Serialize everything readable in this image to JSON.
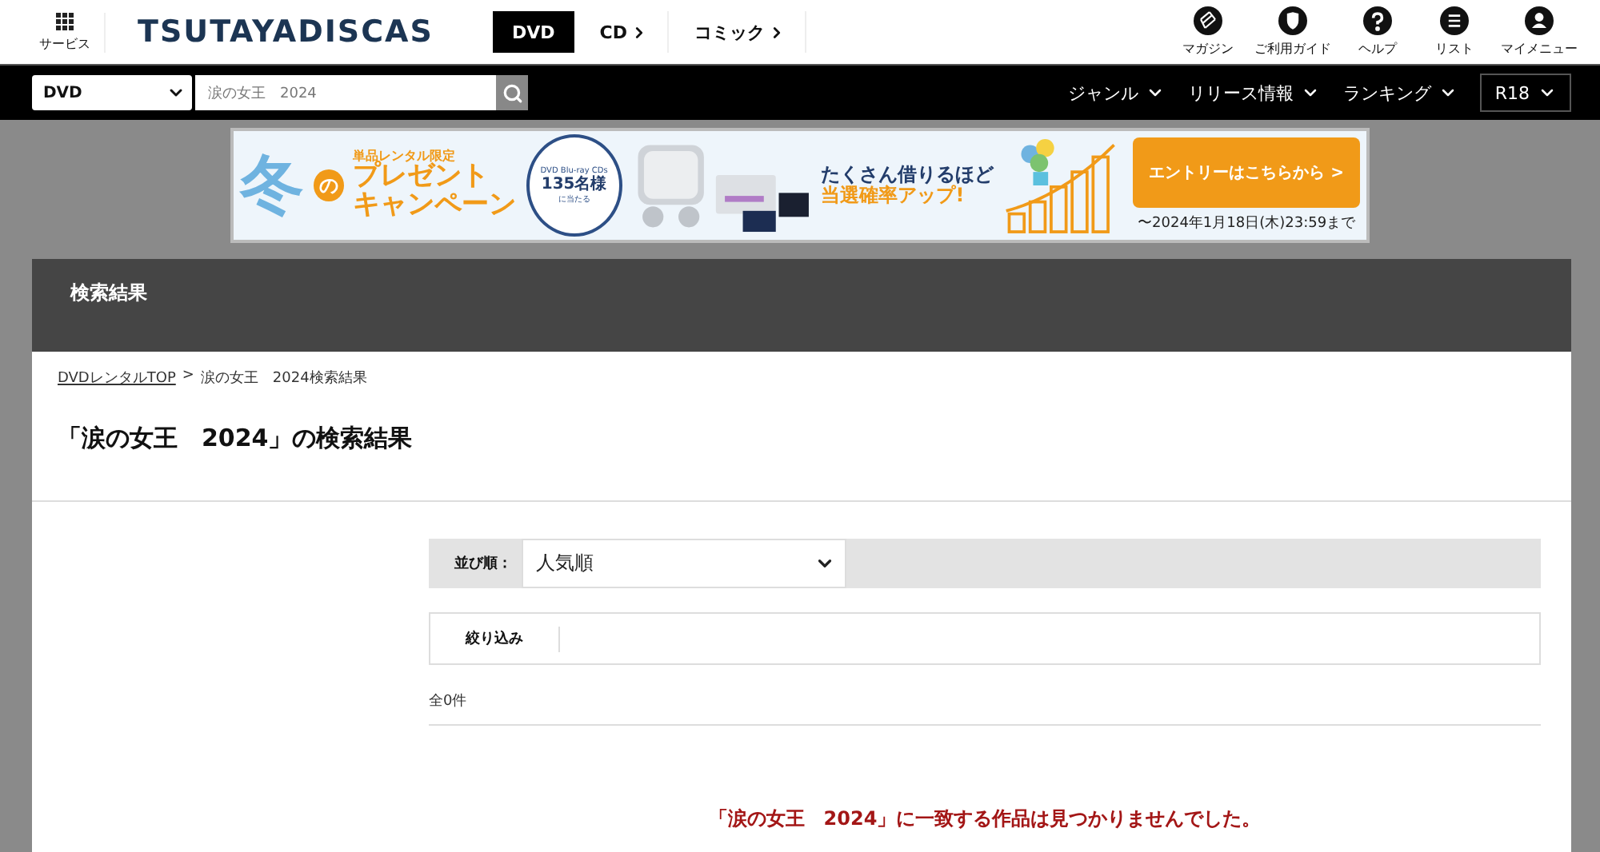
{
  "header": {
    "service_label": "サービス",
    "logo": "TSUTAYADISCAS",
    "media_tabs": [
      {
        "label": "DVD",
        "selected": true
      },
      {
        "label": "CD",
        "selected": false
      },
      {
        "label": "コミック",
        "selected": false
      }
    ],
    "utility_links": [
      {
        "label": "マガジン"
      },
      {
        "label": "ご利用ガイド"
      },
      {
        "label": "ヘルプ"
      },
      {
        "label": "リスト"
      },
      {
        "label": "マイメニュー"
      }
    ]
  },
  "search_bar": {
    "category": "DVD",
    "query": "涙の女王　2024",
    "menus": [
      {
        "label": "ジャンル",
        "kind": "plain"
      },
      {
        "label": "リリース情報",
        "kind": "plain"
      },
      {
        "label": "ランキング",
        "kind": "plain"
      },
      {
        "label": "R18",
        "kind": "boxed"
      }
    ]
  },
  "banner": {
    "season": "冬",
    "particle": "の",
    "ribbon": "単品レンタル限定",
    "title_1": "プレゼント",
    "title_2": "キャンペーン",
    "badge_top": "DVD Blu-ray CDs",
    "badge_count": "135名様",
    "badge_bottom": "に当たる",
    "tagline_1": "たくさん借りるほど",
    "tagline_2": "当選確率アップ!",
    "cta": "エントリーはこちらから >",
    "deadline": "〜2024年1月18日(木)23:59まで"
  },
  "panel": {
    "title": "検索結果",
    "breadcrumb": [
      {
        "label": "DVDレンタルTOP",
        "kind": "link"
      },
      {
        "label": "涙の女王　2024検索結果",
        "kind": "current"
      }
    ],
    "breadcrumb_separator": ">",
    "heading": "「涙の女王　2024」の検索結果",
    "sort": {
      "label": "並び順：",
      "value": "人気順"
    },
    "filter_label": "絞り込み",
    "count": "全0件",
    "message": "「涙の女王　2024」に一致する作品は見つかりませんでした。"
  }
}
